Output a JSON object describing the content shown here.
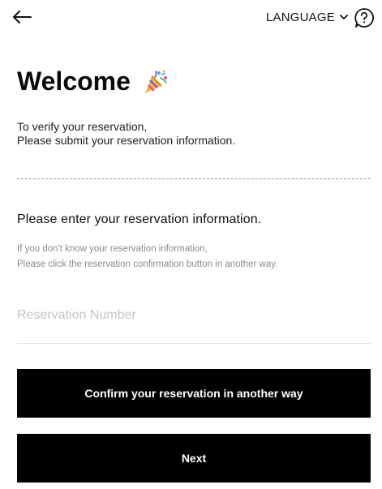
{
  "header": {
    "back_icon": "arrow-left-icon",
    "language_label": "LANGUAGE",
    "language_icon": "chevron-down-icon",
    "help_icon": "question-circle-icon"
  },
  "welcome": {
    "title": "Welcome",
    "icon": "party-popper-icon"
  },
  "intro": {
    "line1": "To verify your reservation,",
    "line2": "Please submit your reservation information."
  },
  "form": {
    "section_title": "Please enter your reservation information.",
    "hint_line1": "If you don't know your reservation information,",
    "hint_line2": "Please click the reservation confirmation button in another way.",
    "reservation_number": {
      "value": "",
      "placeholder": "Reservation Number"
    }
  },
  "buttons": {
    "alt_label": "Confirm your reservation in another way",
    "next_label": "Next"
  },
  "colors": {
    "primary": "#000000",
    "text": "#111111",
    "muted": "#8a8a8a",
    "placeholder": "#c4c4c4"
  }
}
